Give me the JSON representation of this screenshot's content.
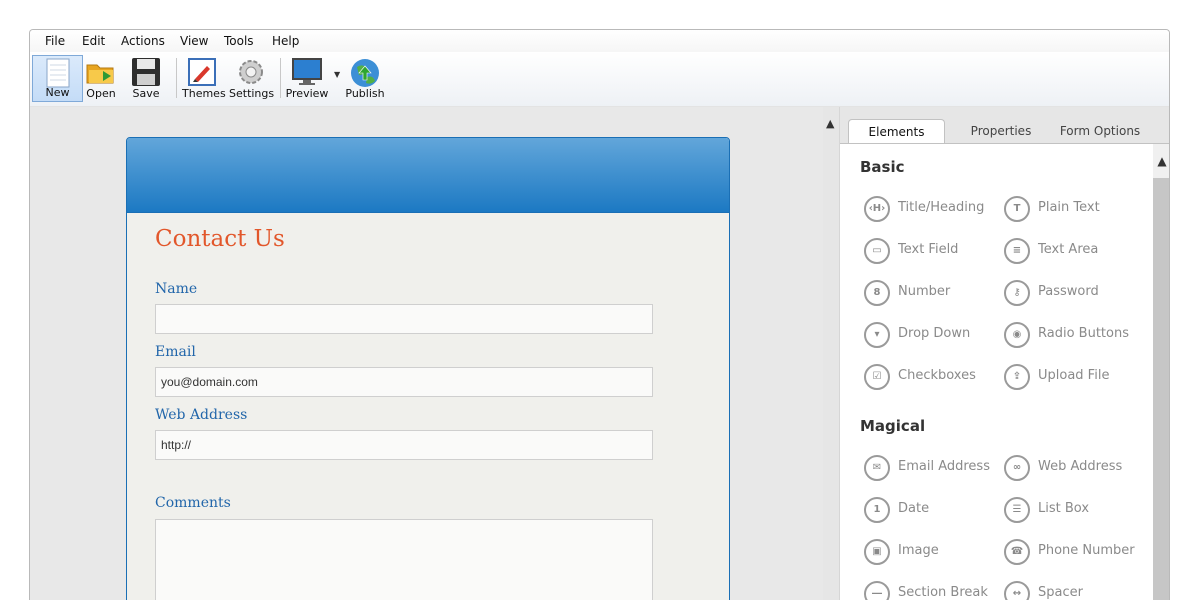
{
  "menu": [
    "File",
    "Edit",
    "Actions",
    "View",
    "Tools",
    "Help"
  ],
  "toolbar": {
    "new": "New",
    "open": "Open",
    "save": "Save",
    "themes": "Themes",
    "settings": "Settings",
    "preview": "Preview",
    "publish": "Publish"
  },
  "form": {
    "title": "Contact Us",
    "fields": [
      {
        "label": "Name",
        "value": ""
      },
      {
        "label": "Email",
        "value": "you@domain.com"
      },
      {
        "label": "Web Address",
        "value": "http://"
      },
      {
        "label": "Comments",
        "value": ""
      }
    ]
  },
  "panel": {
    "tabs": [
      "Elements",
      "Properties",
      "Form Options"
    ],
    "basic_title": "Basic",
    "magical_title": "Magical",
    "basic": [
      {
        "label": "Title/Heading",
        "icon": "heading-icon",
        "glyph": "‹H›"
      },
      {
        "label": "Plain Text",
        "icon": "text-icon",
        "glyph": "T"
      },
      {
        "label": "Text Field",
        "icon": "text-field-icon",
        "glyph": "▭"
      },
      {
        "label": "Text Area",
        "icon": "text-area-icon",
        "glyph": "≡"
      },
      {
        "label": "Number",
        "icon": "number-icon",
        "glyph": "8"
      },
      {
        "label": "Password",
        "icon": "key-icon",
        "glyph": "⚷"
      },
      {
        "label": "Drop Down",
        "icon": "dropdown-icon",
        "glyph": "▾"
      },
      {
        "label": "Radio Buttons",
        "icon": "radio-icon",
        "glyph": "◉"
      },
      {
        "label": "Checkboxes",
        "icon": "checkbox-icon",
        "glyph": "☑"
      },
      {
        "label": "Upload File",
        "icon": "upload-icon",
        "glyph": "⇪"
      }
    ],
    "magical": [
      {
        "label": "Email Address",
        "icon": "email-icon",
        "glyph": "✉"
      },
      {
        "label": "Web Address",
        "icon": "link-icon",
        "glyph": "∞"
      },
      {
        "label": "Date",
        "icon": "calendar-icon",
        "glyph": "1"
      },
      {
        "label": "List Box",
        "icon": "list-box-icon",
        "glyph": "☰"
      },
      {
        "label": "Image",
        "icon": "image-icon",
        "glyph": "▣"
      },
      {
        "label": "Phone Number",
        "icon": "phone-icon",
        "glyph": "☎"
      },
      {
        "label": "Section Break",
        "icon": "section-break-icon",
        "glyph": "―"
      },
      {
        "label": "Spacer",
        "icon": "spacer-icon",
        "glyph": "↔"
      }
    ]
  }
}
